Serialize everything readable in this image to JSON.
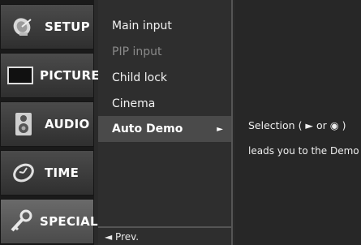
{
  "categories": [
    {
      "label": "SETUP",
      "icon": "satellite-dish-icon"
    },
    {
      "label": "PICTURE",
      "icon": "tv-screen-icon"
    },
    {
      "label": "AUDIO",
      "icon": "speaker-icon"
    },
    {
      "label": "TIME",
      "icon": "clock-icon"
    },
    {
      "label": "SPECIAL",
      "icon": "key-icon"
    }
  ],
  "active_category": "SPECIAL",
  "submenu": {
    "items": [
      {
        "label": "Main input",
        "state": "normal"
      },
      {
        "label": "PIP input",
        "state": "disabled"
      },
      {
        "label": "Child lock",
        "state": "normal"
      },
      {
        "label": "Cinema",
        "state": "normal"
      },
      {
        "label": "Auto Demo",
        "state": "selected"
      }
    ],
    "selected_arrow": "►",
    "prev_label": "◄ Prev."
  },
  "description": {
    "line1": "Selection ( ► or ◉ )",
    "line2": "leads you to the Demo"
  }
}
